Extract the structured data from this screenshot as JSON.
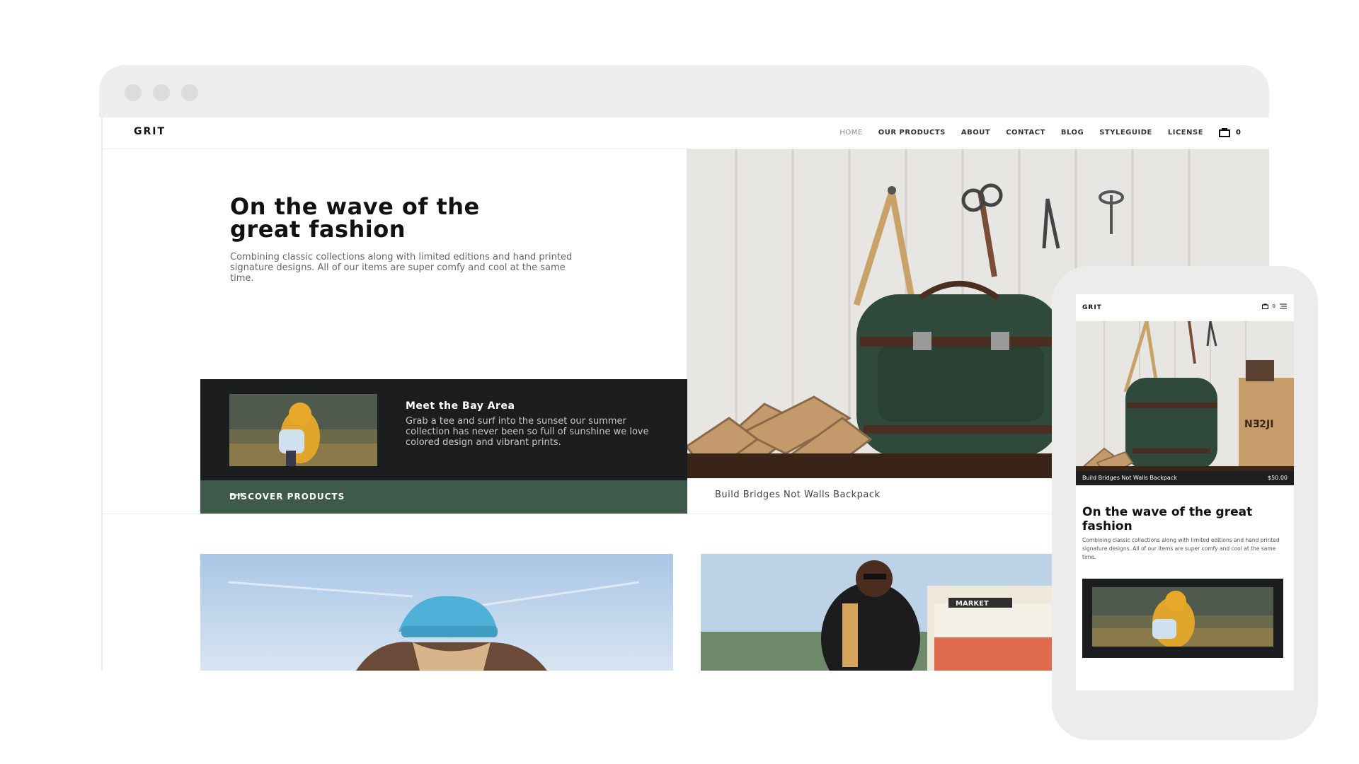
{
  "site": {
    "logo": "GRIT",
    "nav": [
      "HOME",
      "OUR PRODUCTS",
      "ABOUT",
      "CONTACT",
      "BLOG",
      "STYLEGUIDE",
      "LICENSE"
    ],
    "cart_count": "0"
  },
  "hero": {
    "title_line1": "On the wave of the",
    "title_line2": "great fashion",
    "subtitle": "Combining classic collections along with limited editions and hand printed signature designs. All of our items are super comfy and cool at the same time."
  },
  "card": {
    "title": "Meet the Bay Area",
    "text": "Grab a tee and surf into the sunset our summer collection has never been so full of sunshine we love colored design and vibrant prints.",
    "cta": "DISCOVER PRODUCTS",
    "cta_arrow": "⟶"
  },
  "product": {
    "name": "Build Bridges Not Walls Backpack"
  },
  "mobile": {
    "logo": "GRIT",
    "cart_count": "0",
    "product_name": "Build Bridges Not Walls Backpack",
    "price": "$50.00",
    "title": "On the wave of the great fashion",
    "subtitle": "Combining classic collections along with limited editions and hand printed signature designs. All of our items are super comfy and cool at the same time."
  },
  "colors": {
    "accent_green": "#3e5a4b",
    "card_dark": "#1b1d1f",
    "browser_bar": "#eeeeee"
  }
}
